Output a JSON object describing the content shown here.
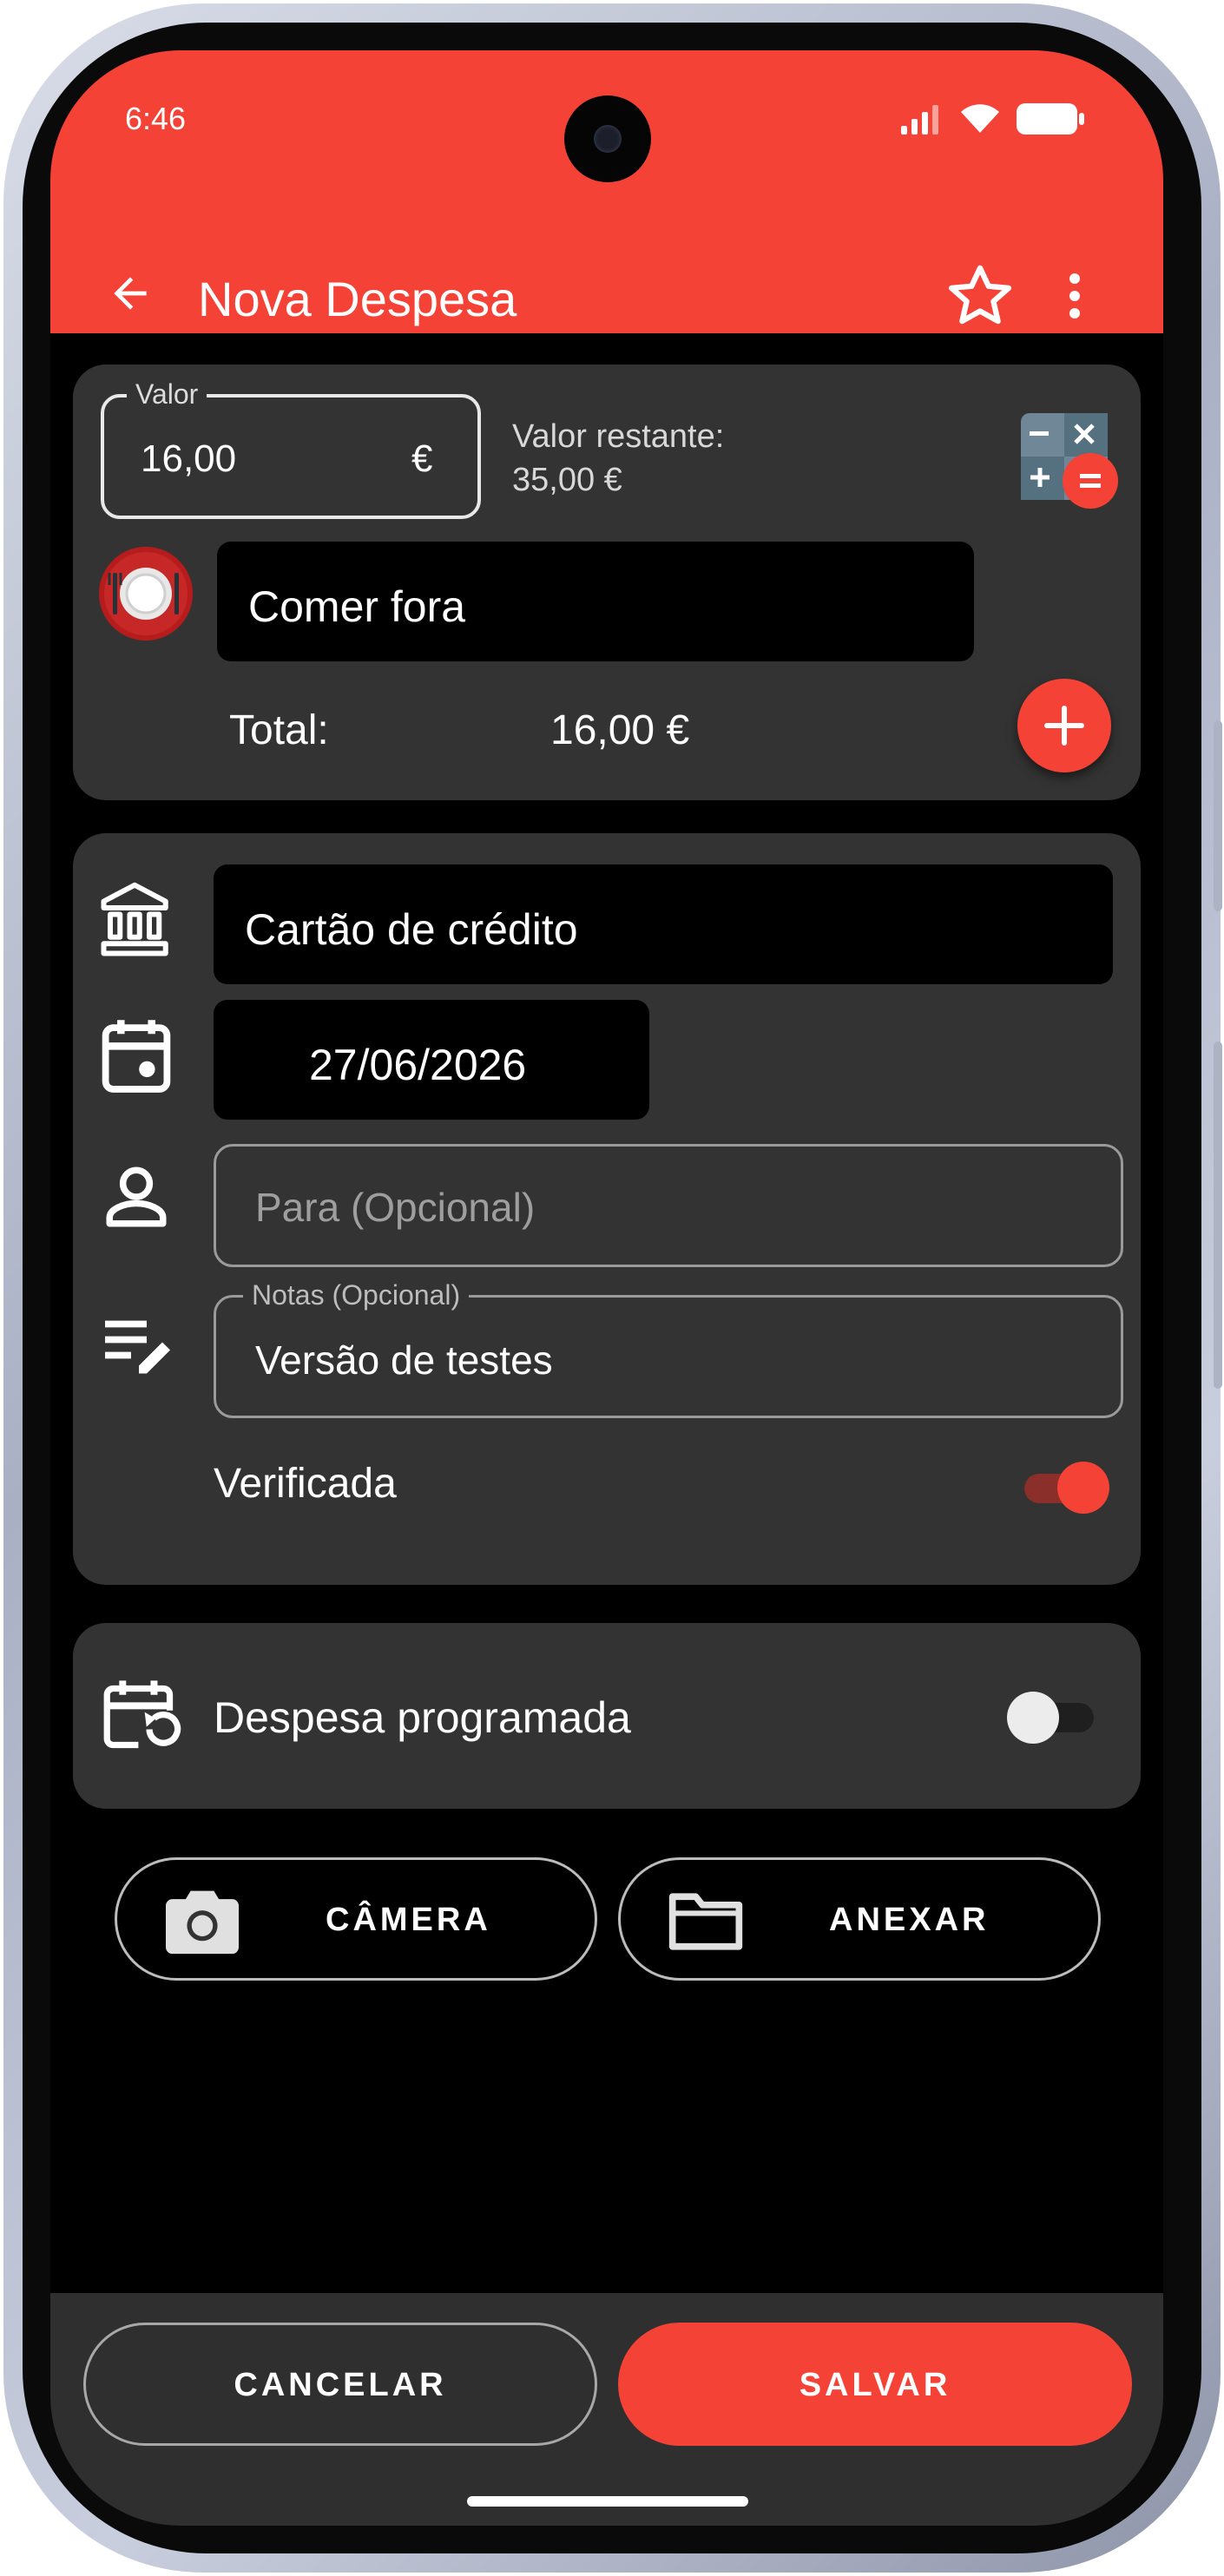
{
  "status": {
    "time": "6:46"
  },
  "app_bar": {
    "title": "Nova Despesa"
  },
  "amount": {
    "label": "Valor",
    "value": "16,00",
    "currency": "€",
    "remaining_label": "Valor restante:",
    "remaining_value": "35,00 €"
  },
  "category": {
    "name": "Comer fora"
  },
  "total": {
    "label": "Total:",
    "value": "16,00 €"
  },
  "account": {
    "name": "Cartão de crédito"
  },
  "date": {
    "value": "27/06/2026"
  },
  "payee": {
    "placeholder": "Para (Opcional)"
  },
  "notes": {
    "label": "Notas (Opcional)",
    "value": "Versão de testes"
  },
  "verified": {
    "label": "Verificada",
    "on": true
  },
  "scheduled": {
    "label": "Despesa programada",
    "on": false
  },
  "attachments": {
    "camera_label": "CÂMERA",
    "attach_label": "ANEXAR"
  },
  "footer": {
    "cancel_label": "CANCELAR",
    "save_label": "SALVAR"
  },
  "colors": {
    "accent": "#f44336",
    "card": "#333333",
    "background": "#000000"
  },
  "icons": [
    "back-arrow-icon",
    "star-icon",
    "more-vert-icon",
    "calculator-icon",
    "restaurant-icon",
    "add-icon",
    "bank-icon",
    "calendar-icon",
    "person-icon",
    "notes-edit-icon",
    "calendar-repeat-icon",
    "camera-icon",
    "folder-icon"
  ]
}
